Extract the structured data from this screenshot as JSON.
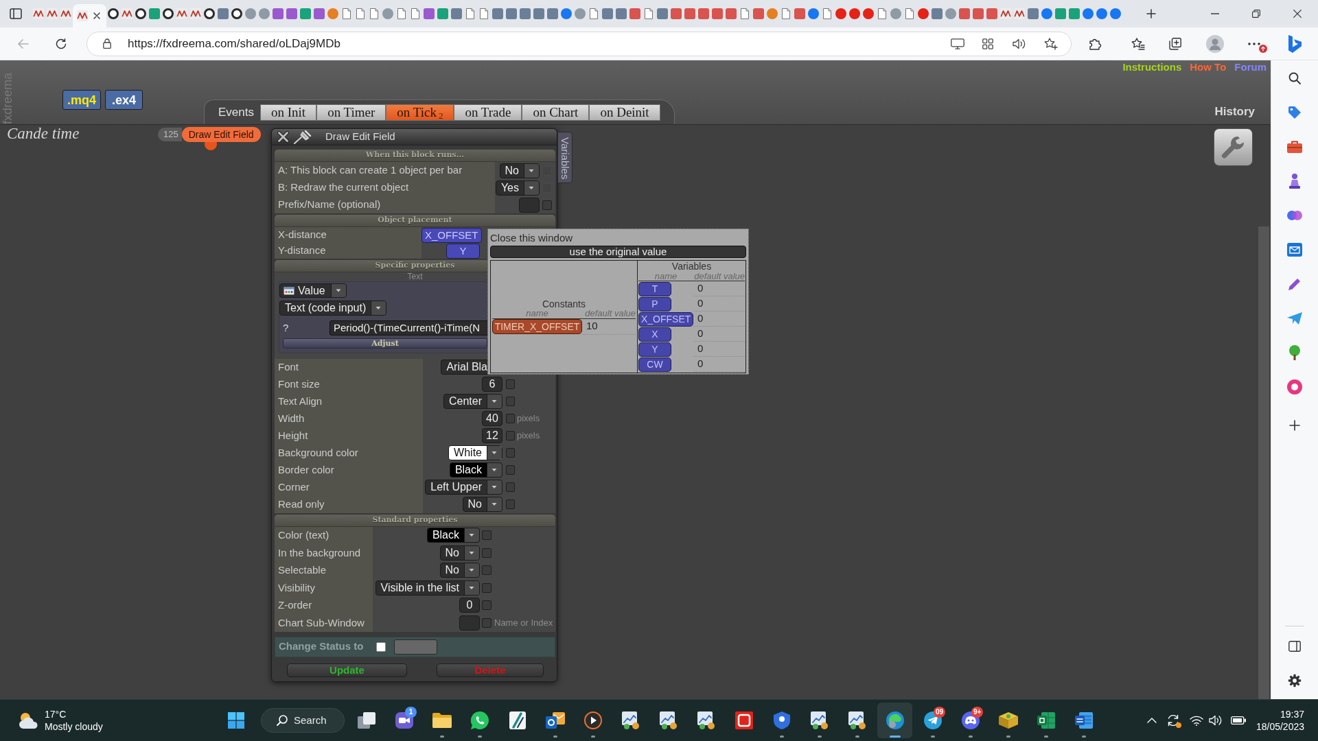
{
  "browser": {
    "tabs": [
      {
        "selected": false
      },
      {
        "selected": false
      },
      {
        "selected": false
      },
      {
        "selected": true
      },
      {
        "selected": false
      },
      {
        "selected": false
      },
      {
        "selected": false
      },
      {
        "selected": false
      },
      {
        "selected": false
      },
      {
        "selected": false
      },
      {
        "selected": false
      },
      {
        "selected": false
      },
      {
        "selected": false
      },
      {
        "selected": false
      },
      {
        "selected": false
      },
      {
        "selected": false
      },
      {
        "selected": false
      },
      {
        "selected": false
      },
      {
        "selected": false
      },
      {
        "selected": false
      },
      {
        "selected": false
      },
      {
        "selected": false
      },
      {
        "selected": false
      },
      {
        "selected": false
      },
      {
        "selected": false
      },
      {
        "selected": false
      },
      {
        "selected": false
      },
      {
        "selected": false
      },
      {
        "selected": false
      },
      {
        "selected": false
      },
      {
        "selected": false
      },
      {
        "selected": false
      },
      {
        "selected": false
      },
      {
        "selected": false
      },
      {
        "selected": false
      },
      {
        "selected": false
      },
      {
        "selected": false
      },
      {
        "selected": false
      },
      {
        "selected": false
      },
      {
        "selected": false
      },
      {
        "selected": false
      },
      {
        "selected": false
      },
      {
        "selected": false
      },
      {
        "selected": false
      },
      {
        "selected": false
      },
      {
        "selected": false
      },
      {
        "selected": false
      },
      {
        "selected": false
      },
      {
        "selected": false
      },
      {
        "selected": false
      },
      {
        "selected": false
      },
      {
        "selected": false
      },
      {
        "selected": false
      },
      {
        "selected": false
      },
      {
        "selected": false
      },
      {
        "selected": false
      },
      {
        "selected": false
      },
      {
        "selected": false
      },
      {
        "selected": false
      },
      {
        "selected": false
      },
      {
        "selected": false
      },
      {
        "selected": false
      },
      {
        "selected": false
      },
      {
        "selected": false
      },
      {
        "selected": false
      },
      {
        "selected": false
      },
      {
        "selected": false
      },
      {
        "selected": false
      },
      {
        "selected": false
      },
      {
        "selected": false
      },
      {
        "selected": false
      },
      {
        "selected": false
      },
      {
        "selected": false
      },
      {
        "selected": false
      },
      {
        "selected": false
      },
      {
        "selected": false
      },
      {
        "selected": false
      },
      {
        "selected": false
      }
    ],
    "url": "https://fxdreema.com/shared/oLDaj9MDb"
  },
  "page": {
    "brand": "fxdreema",
    "exports": [
      {
        "label": ".mq4",
        "color": "#ffea00"
      },
      {
        "label": ".ex4",
        "color": "#ffffff"
      }
    ],
    "events": {
      "label": "Events",
      "tabs": [
        {
          "label": "on Init",
          "selected": false
        },
        {
          "label": "on Timer",
          "selected": false
        },
        {
          "label": "on Tick",
          "count": "2",
          "selected": true
        },
        {
          "label": "on Trade",
          "selected": false
        },
        {
          "label": "on Chart",
          "selected": false
        },
        {
          "label": "on Deinit",
          "selected": false
        }
      ]
    },
    "links": [
      {
        "label": "Instructions",
        "color": "#a6d41c"
      },
      {
        "label": "How To",
        "color": "#ff6633"
      },
      {
        "label": "Forum",
        "color": "#8585ff"
      }
    ],
    "history": "History",
    "project": "Cande time",
    "block": {
      "number": "125",
      "title": "Draw Edit Field"
    }
  },
  "dialog": {
    "title": "Draw Edit Field",
    "side_tab": "Variables",
    "sections": [
      {
        "title": "When this block runs...",
        "rows": [
          {
            "label": "A: This block can create 1 object per bar",
            "kind": "dropdown",
            "value": "No",
            "checkbox": {
              "checked": false,
              "disabled": true
            }
          },
          {
            "label": "B: Redraw the current object",
            "kind": "dropdown",
            "value": "Yes",
            "checkbox": {
              "checked": false,
              "disabled": true
            }
          },
          {
            "label": "Prefix/Name (optional)",
            "kind": "input",
            "checkbox": {
              "checked": false,
              "disabled": false
            }
          }
        ]
      },
      {
        "title": "Object placement",
        "rows": [
          {
            "label": "X-distance",
            "kind": "variable",
            "value": "X_OFFSET"
          },
          {
            "label": "Y-distance",
            "kind": "variable",
            "value": "Y"
          }
        ]
      },
      {
        "title": "Specific properties",
        "subtitle": "Text",
        "source": "Value",
        "input_type": "Text (code input)",
        "code": {
          "label": "?",
          "value": "Period()-(TimeCurrent()-iTime(N"
        },
        "adjust": "Adjust",
        "rows": [
          {
            "label": "Font",
            "kind": "clipped",
            "value": "Arial Bla"
          },
          {
            "label": "Font size",
            "kind": "input",
            "value": "6",
            "checkbox": {
              "checked": false,
              "disabled": false
            }
          },
          {
            "label": "Text Align",
            "kind": "dropdown",
            "value": "Center",
            "checkbox": {
              "checked": false,
              "disabled": false
            }
          },
          {
            "label": "Width",
            "kind": "input",
            "value": "40",
            "checkbox": {
              "checked": false,
              "disabled": false
            },
            "suffix": "pixels"
          },
          {
            "label": "Height",
            "kind": "input",
            "value": "12",
            "checkbox": {
              "checked": false,
              "disabled": false
            },
            "suffix": "pixels"
          },
          {
            "label": "Background color",
            "kind": "dropdown",
            "value": "White",
            "color": "#ffffff",
            "checkbox": {
              "checked": false,
              "disabled": false
            }
          },
          {
            "label": "Border color",
            "kind": "dropdown",
            "value": "Black",
            "color": "#000000",
            "checkbox": {
              "checked": false,
              "disabled": false
            }
          },
          {
            "label": "Corner",
            "kind": "dropdown",
            "value": "Left Upper",
            "checkbox": {
              "checked": false,
              "disabled": false
            }
          },
          {
            "label": "Read only",
            "kind": "dropdown",
            "value": "No",
            "checkbox": {
              "checked": false,
              "disabled": false
            }
          }
        ]
      },
      {
        "title": "Standard properties",
        "rows": [
          {
            "label": "Color (text)",
            "kind": "dropdown",
            "value": "Black",
            "color": "#000000",
            "checkbox": {
              "checked": false,
              "disabled": false
            }
          },
          {
            "label": "In the background",
            "kind": "dropdown",
            "value": "No",
            "checkbox": {
              "checked": false,
              "disabled": false
            }
          },
          {
            "label": "Selectable",
            "kind": "dropdown",
            "value": "No",
            "checkbox": {
              "checked": false,
              "disabled": false
            }
          },
          {
            "label": "Visibility",
            "kind": "dropdown",
            "value": "Visible in the list",
            "checkbox": {
              "checked": false,
              "disabled": false
            }
          },
          {
            "label": "Z-order",
            "kind": "input",
            "value": "0",
            "checkbox": {
              "checked": false,
              "disabled": false
            }
          },
          {
            "label": "Chart Sub-Window",
            "kind": "input",
            "checkbox": {
              "checked": false,
              "disabled": false
            },
            "suffix": "Name or Index"
          }
        ]
      }
    ],
    "status": {
      "label": "Change Status to",
      "checked": false
    },
    "buttons": [
      {
        "label": "Update",
        "kind": "update"
      },
      {
        "label": "Delete",
        "kind": "delete"
      }
    ]
  },
  "popup": {
    "close": "Close this window",
    "reset": "use the original value",
    "groups": [
      {
        "kind": "constant",
        "title": "Constants",
        "columns": [
          "name",
          "default value"
        ],
        "items": [
          {
            "name": "TIMER_X_OFFSET",
            "value": "10"
          }
        ]
      },
      {
        "kind": "variable",
        "title": "Variables",
        "columns": [
          "name",
          "default value"
        ],
        "items": [
          {
            "name": "T",
            "value": "0"
          },
          {
            "name": "P",
            "value": "0"
          },
          {
            "name": "X_OFFSET",
            "value": "0"
          },
          {
            "name": "X",
            "value": "0"
          },
          {
            "name": "Y",
            "value": "0"
          },
          {
            "name": "CW",
            "value": "0"
          }
        ]
      }
    ]
  },
  "taskbar": {
    "weather": {
      "temperature": "17°C",
      "condition": "Mostly cloudy"
    },
    "search": "Search",
    "apps": [
      {
        "running": false,
        "selected": false
      },
      {
        "running": false,
        "selected": false,
        "badge": {
          "text": "1",
          "color": "#4f8ef7"
        }
      },
      {
        "running": true,
        "selected": false
      },
      {
        "running": true,
        "selected": false
      },
      {
        "running": false,
        "selected": false
      },
      {
        "running": true,
        "selected": false
      },
      {
        "running": true,
        "selected": false
      },
      {
        "running": false,
        "selected": false
      },
      {
        "running": false,
        "selected": false
      },
      {
        "running": false,
        "selected": false
      },
      {
        "running": false,
        "selected": false
      },
      {
        "running": true,
        "selected": false
      },
      {
        "running": true,
        "selected": false
      },
      {
        "running": true,
        "selected": false
      },
      {
        "running": true,
        "selected": true
      },
      {
        "running": true,
        "selected": false,
        "badge": {
          "text": "09",
          "color": "#e5413c"
        }
      },
      {
        "running": true,
        "selected": false,
        "badge": {
          "text": "9+",
          "color": "#e5413c"
        }
      },
      {
        "running": true,
        "selected": false
      },
      {
        "running": true,
        "selected": false
      },
      {
        "running": true,
        "selected": false
      }
    ],
    "clock": {
      "time": "19:37",
      "date": "18/05/2023"
    }
  }
}
